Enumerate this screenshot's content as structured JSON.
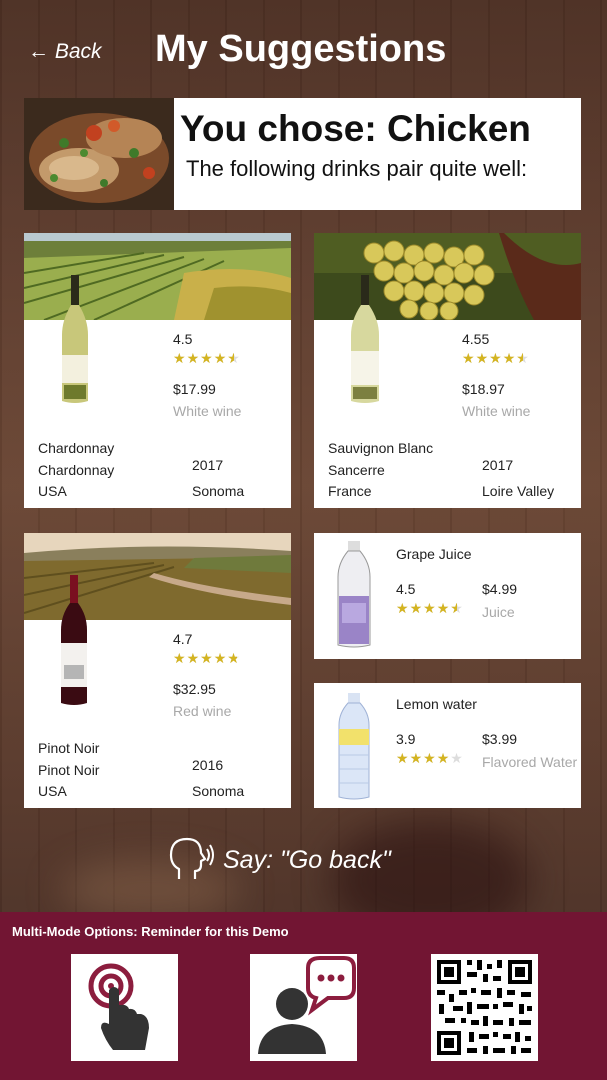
{
  "header": {
    "back_label": "← Back",
    "title": "My Suggestions"
  },
  "hero": {
    "chose": "You chose: Chicken",
    "subtitle": "The following drinks pair quite well:"
  },
  "cards": [
    {
      "rating": "4.5",
      "stars": 4.5,
      "price": "$17.99",
      "type": "White wine",
      "name": "Chardonnay",
      "varietal": "Chardonnay",
      "year": "2017",
      "country": "USA",
      "region": "Sonoma"
    },
    {
      "rating": "4.55",
      "stars": 4.5,
      "price": "$18.97",
      "type": "White wine",
      "name": "Sauvignon Blanc",
      "varietal": "Sancerre",
      "year": "2017",
      "country": "France",
      "region": "Loire Valley"
    },
    {
      "rating": "4.7",
      "stars": 4.7,
      "price": "$32.95",
      "type": "Red wine",
      "name": "Pinot Noir",
      "varietal": "Pinot Noir",
      "year": "2016",
      "country": "USA",
      "region": "Sonoma"
    }
  ],
  "small_cards": [
    {
      "name": "Grape Juice",
      "rating": "4.5",
      "stars": 4.5,
      "price": "$4.99",
      "type": "Juice"
    },
    {
      "name": "Lemon water",
      "rating": "3.9",
      "stars": 3.9,
      "price": "$3.99",
      "type": "Flavored Water"
    }
  ],
  "voice": {
    "hint": "Say: \"Go back\""
  },
  "footer": {
    "label": "Multi-Mode Options: Reminder for this Demo"
  },
  "colors": {
    "footer": "#721533",
    "star": "#d4b421",
    "muted": "#a8a8a8"
  },
  "icons": [
    "back-arrow-icon",
    "speaking-head-icon",
    "touch-icon",
    "voice-chat-icon",
    "qr-code-icon"
  ]
}
